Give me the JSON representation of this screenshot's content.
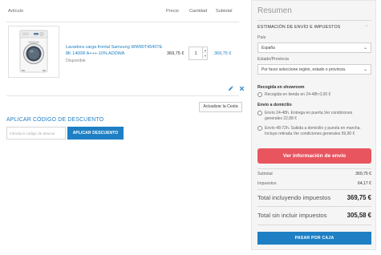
{
  "cart": {
    "headers": {
      "article": "Artículo",
      "price": "Precio",
      "quantity": "Cantidad",
      "subtotal": "Subtotal"
    },
    "item": {
      "name": "Lavadora carga frontal Samsung WW80T4540TE 8K 1400R A+++-10% ADDWA",
      "availability": "Disponible",
      "price": "369,75 €",
      "quantity": "1",
      "subtotal": "369,75 €"
    },
    "update_label": "Actualizar la Cesta"
  },
  "coupon": {
    "title": "APLICAR CÓDIGO DE DESCUENTO",
    "placeholder": "Introducir código de descue",
    "button_label": "APLICAR DESCUENTO"
  },
  "summary": {
    "title": "Resumen",
    "estimate_heading": "ESTIMACIÓN DE ENVÍO E IMPUESTOS",
    "country_label": "País",
    "country_value": "España",
    "region_label": "Estado/Provincia",
    "region_value": "Por favor seleccione región, estado o provincia.",
    "pickup_heading": "Recogida en showroom",
    "pickup_option": "Recogida en tienda en 24-48h 0,00 €",
    "delivery_heading": "Envío a domicilio",
    "delivery_options": [
      "Envío 24-48h. Entrega en puerta.Ver condiciones generales 22,88 €",
      "Envío 48-72h. Subida a domicilio y puesta en marcha. Incluye retirada.Ver condiciones generales 59,90 €"
    ],
    "ship_info_label": "Ver información de envío",
    "subtotal_label": "Subtotal",
    "subtotal_value": "369,75 €",
    "tax_label": "Impuestos",
    "tax_value": "64,17 €",
    "total_incl_label": "Total incluyendo impuestos",
    "total_incl_value": "369,75 €",
    "total_excl_label": "Total sin incluir impuestos",
    "total_excl_value": "305,58 €",
    "checkout_label": "PASAR POR CAJA"
  },
  "colors": {
    "link": "#1e7fc4",
    "primary_button": "#1e7fc4",
    "ship_button": "#e8555f",
    "summary_background": "#f5f5f5"
  }
}
